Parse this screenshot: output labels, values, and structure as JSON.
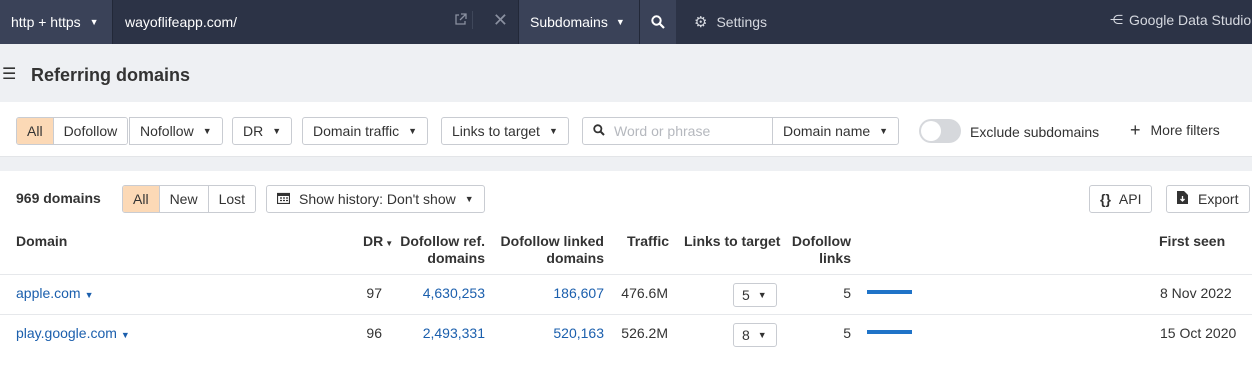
{
  "topbar": {
    "protocol": "http + https",
    "url": "wayoflifeapp.com/",
    "mode": "Subdomains",
    "settings": "Settings",
    "gds": "Google Data Studio"
  },
  "page": {
    "title": "Referring domains"
  },
  "filters": {
    "link_types": [
      "All",
      "Dofollow"
    ],
    "nofollow": "Nofollow",
    "dr": "DR",
    "domain_traffic": "Domain traffic",
    "links_to_target": "Links to target",
    "search_placeholder": "Word or phrase",
    "search_value": "",
    "search_scope": "Domain name",
    "exclude_subdomains": "Exclude subdomains",
    "exclude_subdomains_on": false,
    "more_filters": "More filters"
  },
  "summary": {
    "count": "969 domains",
    "tabs": [
      "All",
      "New",
      "Lost"
    ],
    "active_tab": "All",
    "history": "Show history: Don't show",
    "api": "API",
    "export": "Export"
  },
  "table": {
    "headers": {
      "domain": "Domain",
      "dr": "DR",
      "dofollow_ref_1": "Dofollow ref.",
      "dofollow_ref_2": "domains",
      "dofollow_linked_1": "Dofollow linked",
      "dofollow_linked_2": "domains",
      "traffic": "Traffic",
      "links_to_target": "Links to target",
      "dofollow_links_1": "Dofollow",
      "dofollow_links_2": "links",
      "first_seen": "First seen"
    },
    "rows": [
      {
        "domain": "apple.com",
        "dr": "97",
        "ref_domains": "4,630,253",
        "linked_domains": "186,607",
        "traffic": "476.6M",
        "links_to_target": "5",
        "dofollow_links": "5",
        "first_seen": "8 Nov 2022"
      },
      {
        "domain": "play.google.com",
        "dr": "96",
        "ref_domains": "2,493,331",
        "linked_domains": "520,163",
        "traffic": "526.2M",
        "links_to_target": "8",
        "dofollow_links": "5",
        "first_seen": "15 Oct 2020"
      }
    ]
  },
  "colors": {
    "topbar": "#2c3346",
    "active_segment": "#fcd9b6",
    "link": "#1b5fad",
    "bar": "#1f73c8"
  }
}
